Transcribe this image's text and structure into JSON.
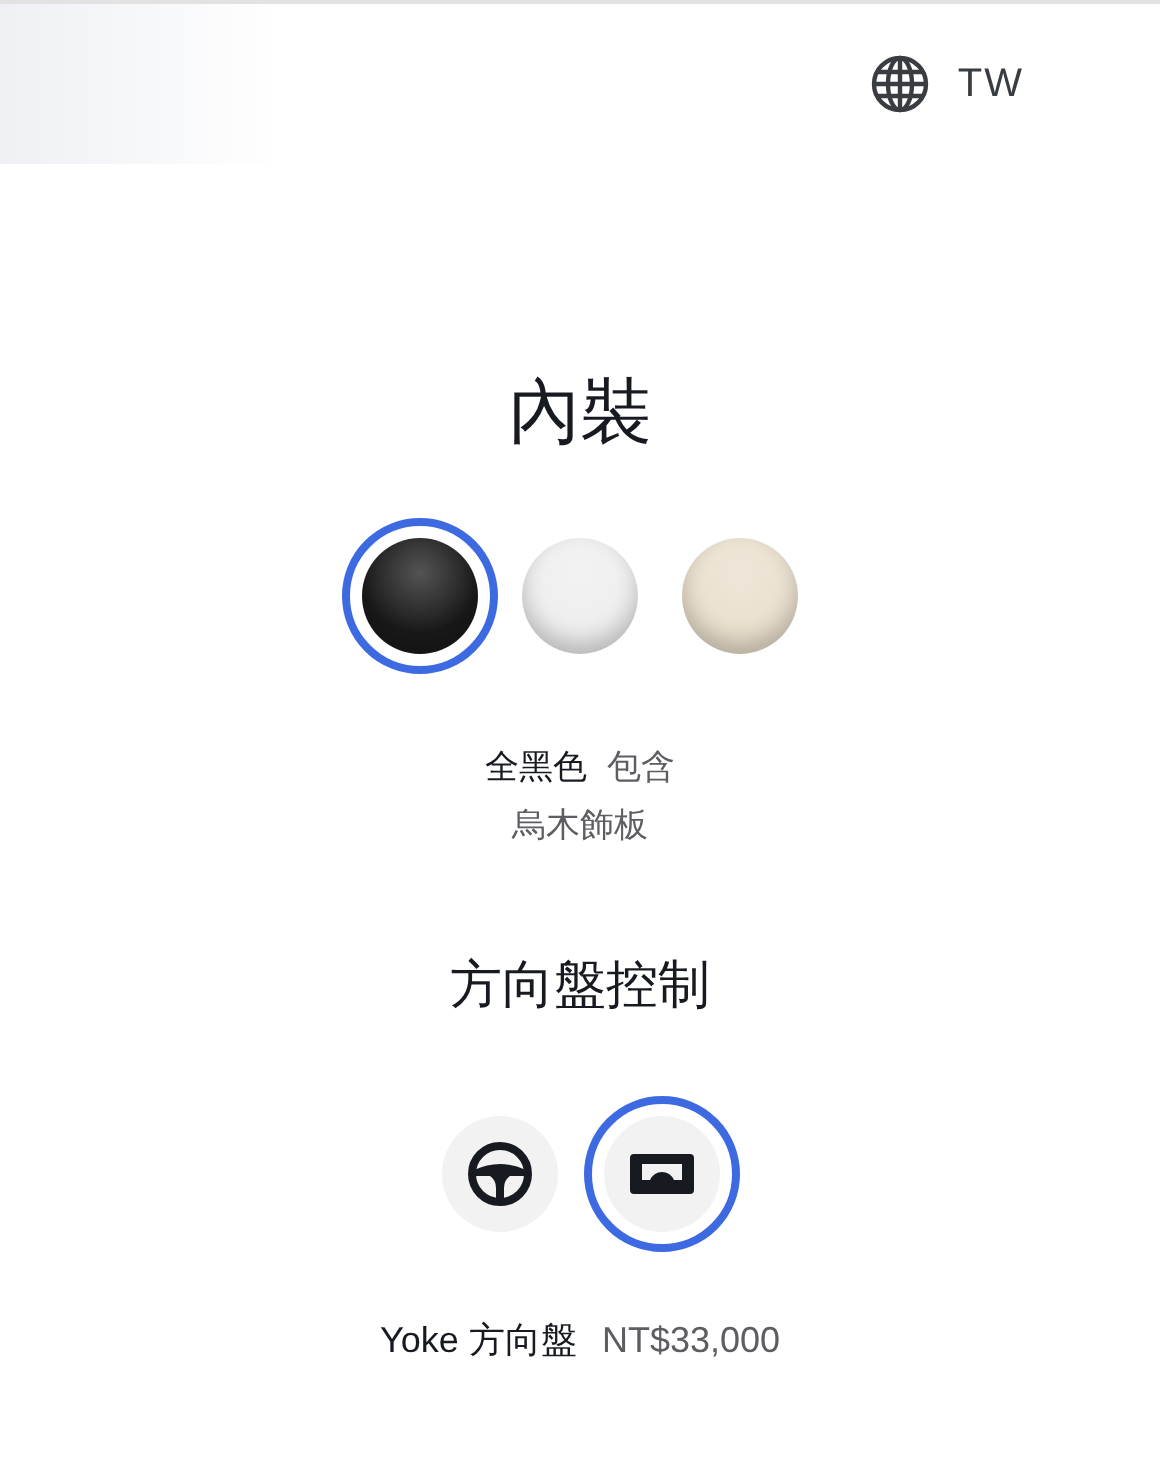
{
  "header": {
    "region": "TW"
  },
  "interior": {
    "title": "內裝",
    "options": [
      {
        "color": "#1a1a1a",
        "selected": true
      },
      {
        "color": "#eeeeee",
        "selected": false
      },
      {
        "color": "#e9dfcd",
        "selected": false
      }
    ],
    "name": "全黑色",
    "detail": "包含烏木飾板"
  },
  "steering": {
    "title": "方向盤控制",
    "options": [
      {
        "kind": "wheel",
        "selected": false
      },
      {
        "kind": "yoke",
        "selected": true
      }
    ],
    "name": "Yoke 方向盤",
    "price": "NT$33,000"
  }
}
